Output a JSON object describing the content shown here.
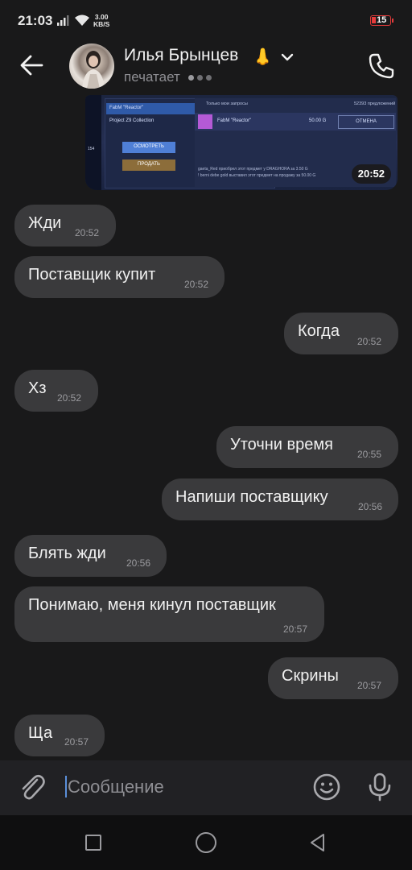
{
  "status_bar": {
    "time": "21:03",
    "net_speed_value": "3.00",
    "net_speed_unit": "KB/S",
    "battery": "15",
    "battery_color": "#e63b3b"
  },
  "header": {
    "contact_name": "Илья Брынцев",
    "emoji": "👃",
    "typing_status": "печатает",
    "icons": [
      "back-arrow-icon",
      "chevron-down-icon",
      "phone-icon"
    ]
  },
  "photo_message": {
    "time": "20:52",
    "screenshot_texts": {
      "item_name": "FabM \"Reactor\"",
      "collection": "Project Z9 Collection",
      "inspect_button": "ОСМОТРЕТЬ",
      "sell_button": "ПРОДАТЬ",
      "filter": "Только мои запросы",
      "requests_count": "52393 предложений",
      "listing_price": "50.00 G",
      "cancel_button": "ОТМЕНА",
      "log_line_1": "gaeta_Red приобрел этот предмет у DRAGHORA за 3.50 G",
      "log_line_2": "! berni debe gold выставил этот предмет на продажу за 50.00 G",
      "side_count": "154"
    }
  },
  "messages": [
    {
      "text": "Жди",
      "time": "20:52",
      "outgoing": false
    },
    {
      "text": "Поставщик купит",
      "time": "20:52",
      "outgoing": false
    },
    {
      "text": "Когда",
      "time": "20:52",
      "outgoing": true
    },
    {
      "text": "Хз",
      "time": "20:52",
      "outgoing": false
    },
    {
      "text": "Уточни время",
      "time": "20:55",
      "outgoing": true
    },
    {
      "text": "Напиши поставщику",
      "time": "20:56",
      "outgoing": true
    },
    {
      "text": "Блять жди",
      "time": "20:56",
      "outgoing": false
    },
    {
      "text": "Понимаю, меня кинул поставщик",
      "time": "20:57",
      "outgoing": false
    },
    {
      "text": "Скрины",
      "time": "20:57",
      "outgoing": true
    },
    {
      "text": "Ща",
      "time": "20:57",
      "outgoing": false
    }
  ],
  "composer": {
    "placeholder": "Сообщение",
    "icons": [
      "paperclip-icon",
      "emoji-icon",
      "microphone-icon"
    ]
  },
  "navigation": {
    "icons": [
      "recent-apps-icon",
      "home-icon",
      "back-icon"
    ]
  },
  "colors": {
    "background": "#19191a",
    "bubble": "#3a3a3c",
    "accent": "#5b8fd9"
  }
}
